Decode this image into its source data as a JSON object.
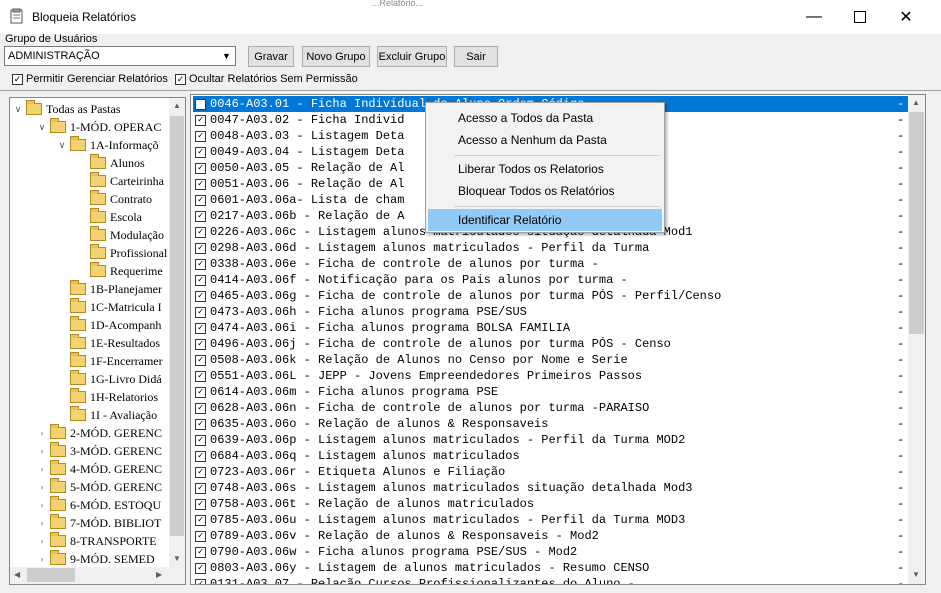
{
  "window": {
    "title": "Bloqueia Relatórios",
    "behind_text": "...Relatório..."
  },
  "toolbar": {
    "group_label": "Grupo de Usuários",
    "group_value": "ADMINISTRAÇÃO",
    "buttons": [
      "Gravar",
      "Novo Grupo",
      "Excluir Grupo",
      "Sair"
    ],
    "checkboxes": [
      {
        "label": "Permitir Gerenciar Relatórios",
        "checked": true
      },
      {
        "label": "Ocultar Relatórios Sem Permissão",
        "checked": true
      }
    ]
  },
  "tree": {
    "items": [
      {
        "label": "Todas as Pastas",
        "level": 0,
        "expanded": true
      },
      {
        "label": "1-MÓD. OPERAC",
        "level": 1,
        "expanded": true
      },
      {
        "label": "1A-Informaçõ",
        "level": 2,
        "expanded": true
      },
      {
        "label": "Alunos",
        "level": 3,
        "open": true
      },
      {
        "label": "Carteirinha",
        "level": 3
      },
      {
        "label": "Contrato",
        "level": 3
      },
      {
        "label": "Escola",
        "level": 3
      },
      {
        "label": "Modulação",
        "level": 3
      },
      {
        "label": "Profissional",
        "level": 3
      },
      {
        "label": "Requerime",
        "level": 3
      },
      {
        "label": "1B-Planejamer",
        "level": 2
      },
      {
        "label": "1C-Matricula I",
        "level": 2
      },
      {
        "label": "1D-Acompanh",
        "level": 2
      },
      {
        "label": "1E-Resultados",
        "level": 2
      },
      {
        "label": "1F-Encerramer",
        "level": 2
      },
      {
        "label": "1G-Livro Didá",
        "level": 2
      },
      {
        "label": "1H-Relatorios",
        "level": 2
      },
      {
        "label": "1I - Avaliação",
        "level": 2
      },
      {
        "label": "2-MÓD. GERENC",
        "level": 1,
        "collapsed": true
      },
      {
        "label": "3-MÓD. GERENC",
        "level": 1,
        "collapsed": true
      },
      {
        "label": "4-MÓD. GERENC",
        "level": 1,
        "collapsed": true
      },
      {
        "label": "5-MÓD. GERENC",
        "level": 1,
        "collapsed": true
      },
      {
        "label": "6-MÓD. ESTOQU",
        "level": 1,
        "collapsed": true
      },
      {
        "label": "7-MÓD. BIBLIOT",
        "level": 1,
        "collapsed": true
      },
      {
        "label": "8-TRANSPORTE",
        "level": 1,
        "collapsed": true
      },
      {
        "label": "9-MÓD. SEMED",
        "level": 1,
        "collapsed": true
      }
    ]
  },
  "reports": [
    "0046-A03.01 - Ficha Individual do Aluno Ordem Código",
    "0047-A03.02 - Ficha Individ",
    "0048-A03.03 - Listagem Deta",
    "0049-A03.04 - Listagem Deta",
    "0050-A03.05 - Relação de Al",
    "0051-A03.06 - Relação de Al",
    "0601-A03.06a- Lista de cham",
    "0217-A03.06b - Relação de A",
    "0226-A03.06c - Listagem alunos matriculados situação detalhada Mod1",
    "0298-A03.06d - Listagem alunos matriculados - Perfil da Turma",
    "0338-A03.06e - Ficha de controle de alunos por turma -",
    "0414-A03.06f - Notificação para os Pais alunos por turma -",
    "0465-A03.06g - Ficha de controle de alunos por turma PÓS - Perfil/Censo",
    "0473-A03.06h - Ficha alunos programa PSE/SUS",
    "0474-A03.06i - Ficha alunos programa BOLSA FAMILIA",
    "0496-A03.06j - Ficha de controle de alunos por turma PÓS - Censo",
    "0508-A03.06k - Relação de Alunos no Censo por Nome e Serie",
    "0551-A03.06L - JEPP - Jovens Empreendedores Primeiros Passos",
    "0614-A03.06m - Ficha alunos programa PSE",
    "0628-A03.06n - Ficha de controle de alunos por turma -PARAISO",
    "0635-A03.06o - Relação de alunos & Responsaveis",
    "0639-A03.06p - Listagem alunos matriculados - Perfil da Turma MOD2",
    "0684-A03.06q - Listagem alunos matriculados",
    "0723-A03.06r - Etiqueta Alunos e Filiação",
    "0748-A03.06s - Listagem alunos matriculados situação detalhada Mod3",
    "0758-A03.06t - Relação de alunos matriculados",
    "0785-A03.06u - Listagem alunos matriculados - Perfil da Turma MOD3",
    "0789-A03.06v - Relação de alunos & Responsaveis - Mod2",
    "0790-A03.06w - Ficha alunos programa PSE/SUS - Mod2",
    "0803-A03.06y - Listagem de alunos matriculados - Resumo CENSO",
    "0131-A03.07 - Relação Cursos Profissionalizantes do Aluno -"
  ],
  "reports_dash": "-",
  "context_menu": {
    "items": [
      "Acesso a Todos da Pasta",
      "Acesso a Nenhum da Pasta",
      "Liberar Todos os Relatorios",
      "Bloquear Todos os Relatórios",
      "Identificar Relatório"
    ],
    "highlighted": "Identificar Relatório"
  }
}
